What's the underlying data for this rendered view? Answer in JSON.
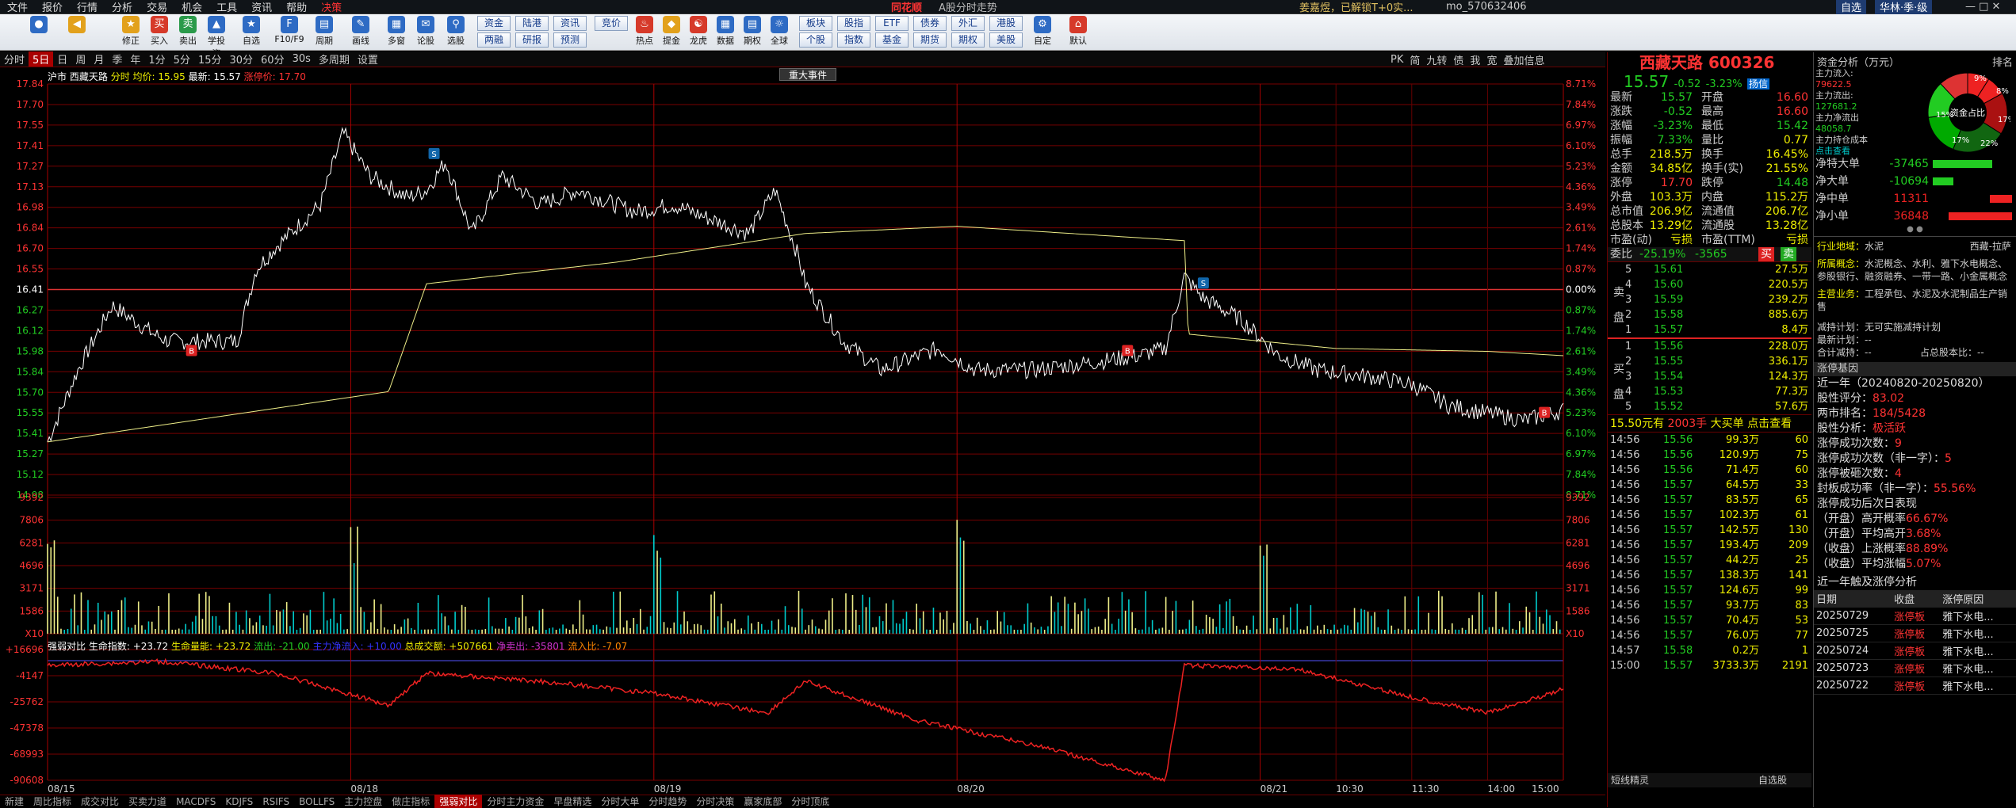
{
  "menu": [
    "文件",
    "报价",
    "行情",
    "分析",
    "交易",
    "机会",
    "工具",
    "资讯",
    "帮助",
    "决策"
  ],
  "brand": "同花顺",
  "app_title": "A股分时走势",
  "user": "姜嘉煜，已解锁T+0实...",
  "user_id": "mo_570632406",
  "sys_buttons": [
    "自选",
    "华林·季·级"
  ],
  "toolbar": {
    "items": [
      "修正",
      "买入",
      "卖出",
      "学投资",
      "自选",
      "F10/F9",
      "周期",
      "画线",
      "多窗",
      "论股",
      "选股",
      "热点",
      "提金",
      "龙虎",
      "数据",
      "期权",
      "全球",
      "自定",
      "默认"
    ],
    "grid_buttons": [
      "资金",
      "陆港",
      "资讯",
      "竞价",
      "两融",
      "研报",
      "预测",
      "板块",
      "股指",
      "ETF",
      "债券",
      "外汇",
      "港股",
      "个股",
      "指数",
      "基金",
      "期货",
      "期权",
      "美股"
    ]
  },
  "period_bar": {
    "items": [
      "分时",
      "5日",
      "日",
      "周",
      "月",
      "季",
      "年",
      "1分",
      "5分",
      "15分",
      "30分",
      "60分",
      "30s",
      "多周期",
      "设置"
    ],
    "selected": "5日"
  },
  "right_bar": [
    "PK",
    "简",
    "九转",
    "债",
    "我",
    "宽",
    "叠加信息"
  ],
  "chart_info": {
    "market": "沪市",
    "name": "西藏天路",
    "label_fs": "分时",
    "avg_label": "均价: 15.95",
    "price_label": "最新: 15.57",
    "limit_label": "涨停价: 17.70"
  },
  "big_event": "重大事件",
  "y_price": [
    "17.84",
    "17.70",
    "17.55",
    "17.41",
    "17.27",
    "17.13",
    "16.98",
    "16.84",
    "16.70",
    "16.55",
    "16.41",
    "16.27",
    "16.12",
    "15.98",
    "15.84",
    "15.70",
    "15.55",
    "15.41",
    "15.27",
    "15.12",
    "14.98"
  ],
  "y_pct": [
    "8.71%",
    "7.84%",
    "6.97%",
    "6.10%",
    "5.23%",
    "4.36%",
    "3.49%",
    "2.61%",
    "1.74%",
    "0.87%",
    "0.00%",
    "0.87%",
    "1.74%",
    "2.61%",
    "3.49%",
    "4.36%",
    "5.23%",
    "6.10%",
    "6.97%",
    "7.84%",
    "8.71%"
  ],
  "y_vol": [
    "9392",
    "7806",
    "6281",
    "4696",
    "3171",
    "1586",
    "X10"
  ],
  "y_ind": [
    "+16696",
    "-4147",
    "-25762",
    "-47378",
    "-68993",
    "-90608"
  ],
  "x_dates": [
    "08/15",
    "08/18",
    "08/19",
    "08/20",
    "08/21",
    "10:30",
    "11:30",
    "14:00",
    "15:00"
  ],
  "indicator_line": {
    "name": "强弱对比",
    "life": "生命指数: +23.72",
    "vol": "生命量能: +23.72",
    "a": "流出: -21.00",
    "b": "主力净流入: +10.00",
    "total": "总成交额: +507661",
    "c": "净卖出: -35801",
    "d": "流入比: -7.07"
  },
  "bottom_tabs": [
    "新建",
    "周比指标",
    "成交对比",
    "买卖力道",
    "MACDFS",
    "KDJFS",
    "RSIFS",
    "BOLLFS",
    "主力控盘",
    "做庄指标",
    "强弱对比",
    "分时主力资金",
    "早盘精选",
    "分时大单",
    "分时趋势",
    "分时决策",
    "赢家底部",
    "分时顶底"
  ],
  "bottom_selected": "强弱对比",
  "stock": {
    "name": "西藏天路",
    "code": "600326",
    "price": "15.57",
    "chg": "-0.52",
    "pct": "-3.23%",
    "tag": "扬信"
  },
  "fund_rows": [
    {
      "k": "最新",
      "v": "15.57",
      "k2": "开盘",
      "v2": "16.60"
    },
    {
      "k": "涨跌",
      "v": "-0.52",
      "k2": "最高",
      "v2": "16.60"
    },
    {
      "k": "涨幅",
      "v": "-3.23%",
      "k2": "最低",
      "v2": "15.42"
    },
    {
      "k": "振幅",
      "v": "7.33%",
      "k2": "量比",
      "v2": "0.77"
    },
    {
      "k": "总手",
      "v": "218.5万",
      "k2": "换手",
      "v2": "16.45%"
    },
    {
      "k": "金额",
      "v": "34.85亿",
      "k2": "换手(实)",
      "v2": "21.55%"
    },
    {
      "k": "涨停",
      "v": "17.70",
      "k2": "跌停",
      "v2": "14.48"
    },
    {
      "k": "外盘",
      "v": "103.3万",
      "k2": "内盘",
      "v2": "115.2万"
    },
    {
      "k": "总市值",
      "v": "206.9亿",
      "k2": "流通值",
      "v2": "206.7亿"
    },
    {
      "k": "总股本",
      "v": "13.29亿",
      "k2": "流通股",
      "v2": "13.28亿"
    },
    {
      "k": "市盈(动)",
      "v": "亏损",
      "k2": "市盈(TTM)",
      "v2": "亏损"
    }
  ],
  "weibi": {
    "label": "委比",
    "pct": "-25.19%",
    "diff": "-3565",
    "buy": "买",
    "sell": "卖"
  },
  "sells": [
    {
      "l": "5",
      "p": "15.61",
      "q": "27.5万"
    },
    {
      "l": "4",
      "p": "15.60",
      "q": "220.5万"
    },
    {
      "l": "3",
      "p": "15.59",
      "q": "239.2万"
    },
    {
      "l": "2",
      "p": "15.58",
      "q": "885.6万"
    },
    {
      "l": "1",
      "p": "15.57",
      "q": "8.4万"
    }
  ],
  "buys": [
    {
      "l": "1",
      "p": "15.56",
      "q": "228.0万"
    },
    {
      "l": "2",
      "p": "15.55",
      "q": "336.1万"
    },
    {
      "l": "3",
      "p": "15.54",
      "q": "124.3万"
    },
    {
      "l": "4",
      "p": "15.53",
      "q": "77.3万"
    },
    {
      "l": "5",
      "p": "15.52",
      "q": "57.6万"
    }
  ],
  "sell_label": "卖盘",
  "buy_label": "买盘",
  "big_order": {
    "a": "15.50元有",
    "b": "2003手",
    "c": "大买单",
    "d": "点击查看"
  },
  "ticks": [
    {
      "t": "14:56",
      "p": "15.56",
      "q": "99.3万",
      "n": "60"
    },
    {
      "t": "14:56",
      "p": "15.56",
      "q": "120.9万",
      "n": "75"
    },
    {
      "t": "14:56",
      "p": "15.56",
      "q": "71.4万",
      "n": "60"
    },
    {
      "t": "14:56",
      "p": "15.57",
      "q": "64.5万",
      "n": "33"
    },
    {
      "t": "14:56",
      "p": "15.57",
      "q": "83.5万",
      "n": "65"
    },
    {
      "t": "14:56",
      "p": "15.57",
      "q": "102.3万",
      "n": "61"
    },
    {
      "t": "14:56",
      "p": "15.57",
      "q": "142.5万",
      "n": "130"
    },
    {
      "t": "14:56",
      "p": "15.57",
      "q": "193.4万",
      "n": "209"
    },
    {
      "t": "14:56",
      "p": "15.57",
      "q": "44.2万",
      "n": "25"
    },
    {
      "t": "14:56",
      "p": "15.57",
      "q": "138.3万",
      "n": "141"
    },
    {
      "t": "14:56",
      "p": "15.57",
      "q": "124.6万",
      "n": "99"
    },
    {
      "t": "14:56",
      "p": "15.57",
      "q": "93.7万",
      "n": "83"
    },
    {
      "t": "14:56",
      "p": "15.57",
      "q": "70.4万",
      "n": "53"
    },
    {
      "t": "14:56",
      "p": "15.57",
      "q": "76.0万",
      "n": "77"
    },
    {
      "t": "14:57",
      "p": "15.58",
      "q": "0.2万",
      "n": "1"
    },
    {
      "t": "15:00",
      "p": "15.57",
      "q": "3733.3万",
      "n": "2191"
    }
  ],
  "panel_footer": {
    "a": "短线精灵",
    "b": "自选股"
  },
  "fund_flow": {
    "title": "资金分析（万元）",
    "rank": "排名",
    "pie_center": "资金占比",
    "labels": [
      "主力流入:",
      "主力流出:",
      "主力净流出",
      "主力持仓成本",
      "点击查看"
    ],
    "values": [
      "79622.5",
      "127681.2",
      "48058.7"
    ],
    "pie_pcts": [
      "9%",
      "8%",
      "17%",
      "22%",
      "17%",
      "15%"
    ],
    "rows": [
      {
        "k": "净特大单",
        "v": "-37465",
        "w": 0.75,
        "c": "#2c2"
      },
      {
        "k": "净大单",
        "v": "-10694",
        "w": 0.26,
        "c": "#2c2"
      },
      {
        "k": "净中单",
        "v": "11311",
        "w": 0.28,
        "c": "#e22"
      },
      {
        "k": "净小单",
        "v": "36848",
        "w": 0.8,
        "c": "#e22"
      }
    ]
  },
  "industry": {
    "k": "行业地域：",
    "v": "水泥",
    "v2": "西藏-拉萨"
  },
  "concepts": {
    "k": "所属概念：",
    "v": "水泥概念、水利、雅下水电概念、参股银行、融资融券、一带一路、小金属概念"
  },
  "business": {
    "k": "主营业务：",
    "v": "工程承包、水泥及水泥制品生产销售"
  },
  "plans": [
    "减持计划：无可实施减持计划",
    "最新计划：--",
    "合计减持：--",
    "占总股本比：--"
  ],
  "zt_title": "涨停基因",
  "zt_rows": [
    {
      "k": "近一年（20240820-20250820）",
      "v": ""
    },
    {
      "k": "股性评分：",
      "v": "83.02"
    },
    {
      "k": "两市排名：",
      "v": "184/5428"
    },
    {
      "k": "股性分析：",
      "v": "极活跃"
    },
    {
      "k": "涨停成功次数：",
      "v": "9"
    },
    {
      "k": "涨停成功次数（非一字）：",
      "v": "5"
    },
    {
      "k": "涨停被砸次数：",
      "v": "4"
    },
    {
      "k": "封板成功率（非一字）：",
      "v": "55.56%"
    },
    {
      "k": "涨停成功后次日表现",
      "v": ""
    },
    {
      "k": "（开盘）高开概率",
      "v": "66.67%"
    },
    {
      "k": "（开盘）平均高开",
      "v": "3.68%"
    },
    {
      "k": "（收盘）上涨概率",
      "v": "88.89%"
    },
    {
      "k": "（收盘）平均涨幅",
      "v": "5.07%"
    }
  ],
  "zt_hist_title": "近一年触及涨停分析",
  "zt_hist_head": [
    "日期",
    "收盘",
    "涨停原因"
  ],
  "zt_hist": [
    [
      "20250729",
      "涨停板",
      "雅下水电..."
    ],
    [
      "20250725",
      "涨停板",
      "雅下水电..."
    ],
    [
      "20250724",
      "涨停板",
      "雅下水电..."
    ],
    [
      "20250723",
      "涨停板",
      "雅下水电..."
    ],
    [
      "20250722",
      "涨停板",
      "雅下水电..."
    ]
  ]
}
